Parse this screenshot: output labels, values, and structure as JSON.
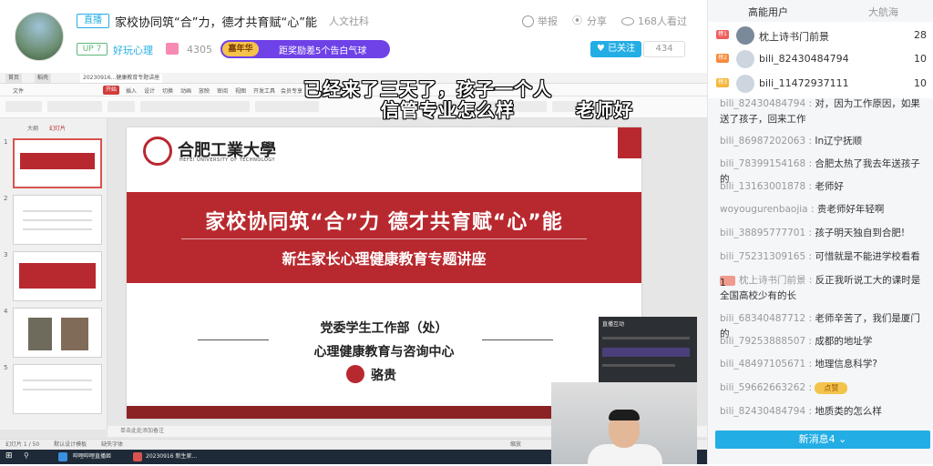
{
  "header": {
    "live_badge": "直播",
    "title": "家校协同筑“合”力，德才共育赋“心”能",
    "category": "人文社科",
    "report_label": "举报",
    "share_label": "分享",
    "watched_label": "168人看过",
    "up_level": "UP 7",
    "area_label": "好玩心理",
    "gift_count": "4305",
    "annual_badge": "嘉年华",
    "annual_text": "距奖励差5个告白气球",
    "follow_label": "已关注",
    "follow_count": "434"
  },
  "subtitles": {
    "line1": "已经来了三天了，孩子一个人",
    "line2": "信管专业怎么样",
    "line3": "老师好"
  },
  "slide": {
    "logo_cn": "合肥工業大學",
    "logo_en": "HEFEI UNIVERSITY OF TECHNOLOGY",
    "title": "家校协同筑“合”力  德才共育赋“心”能",
    "subtitle": "新生家长心理健康教育专题讲座",
    "org1": "党委学生工作部（处）",
    "org2": "心理健康教育与咨询中心",
    "presenter": "骆贵"
  },
  "ppt": {
    "tab_home": "首页",
    "tab_shell": "稻壳",
    "tab_doc": "20230916...健康教育专题讲座",
    "menu_file": "文件",
    "menu_start": "开始",
    "menu_items": [
      "插入",
      "设计",
      "切换",
      "动画",
      "放映",
      "审阅",
      "视图",
      "开发工具",
      "会员专享"
    ],
    "thumb_tab_outline": "大纲",
    "thumb_tab_slides": "幻灯片",
    "notes_hint": "单击此处添加备注",
    "status_left": "幻灯片 1 / 50",
    "status_theme": "默认设计模板",
    "status_font": "缺失字体",
    "status_zoom": "缩放",
    "task_item1": "哔哩哔哩直播姬",
    "task_item2": "20230916 新生家..."
  },
  "overlay": {
    "title": "直播互动"
  },
  "sidebar": {
    "tab_high_energy": "高能用户",
    "tab_voyage": "大航海",
    "ranks": [
      {
        "badge": "榜1",
        "name": "枕上诗书门前景",
        "score": "28",
        "color": "#f25d5d"
      },
      {
        "badge": "榜2",
        "name": "bili_82430484794",
        "score": "10",
        "color": "#f78b3b"
      },
      {
        "badge": "榜3",
        "name": "bili_11472937111",
        "score": "10",
        "color": "#f5b73b"
      }
    ],
    "messages": [
      {
        "user": "bili_82430484794",
        "text": "对，因为工作原因，如果送了孩子，回来工作"
      },
      {
        "user": "bili_86987202063",
        "text": "In辽宁抚顺"
      },
      {
        "user": "bili_78399154168",
        "text": "合肥太热了我去年送孩子的"
      },
      {
        "user": "bili_13163001878",
        "text": "老师好"
      },
      {
        "user": "woyougurenbaojia",
        "text": "贵老师好年轻啊"
      },
      {
        "user": "bili_38895777701",
        "text": "孩子明天独自到合肥!"
      },
      {
        "user": "bili_75231309165",
        "text": "可惜就是不能进学校看看"
      },
      {
        "user": "枕上诗书门前景",
        "text": "反正我听说工大的课时是全国高校少有的长",
        "medal": "1"
      },
      {
        "user": "bili_68340487712",
        "text": "老师辛苦了，我们是厦门的"
      },
      {
        "user": "bili_79253888507",
        "text": "成都的地址学"
      },
      {
        "user": "bili_48497105671",
        "text": "地理信息科学?"
      },
      {
        "user": "bili_59662663262",
        "text": "",
        "emote": "点赞"
      },
      {
        "user": "bili_82430484794",
        "text": "地质类的怎么样"
      }
    ],
    "new_messages": "新消息4"
  }
}
